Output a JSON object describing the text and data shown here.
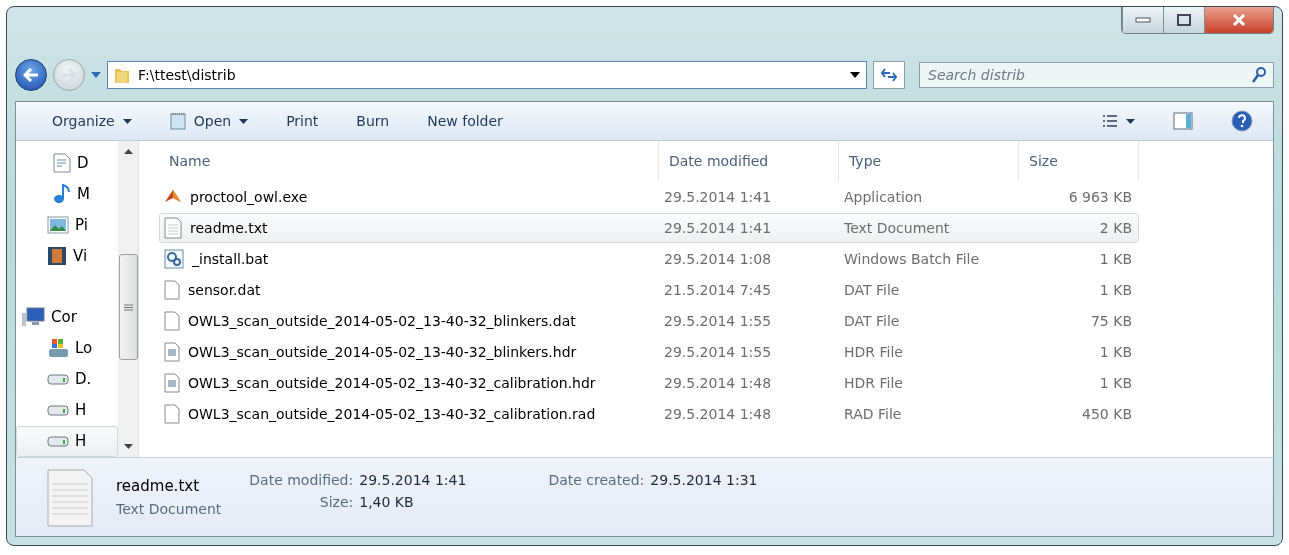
{
  "address": {
    "path": "F:\\ttest\\distrib"
  },
  "search": {
    "placeholder": "Search distrib"
  },
  "toolbar": [
    {
      "label": "Organize",
      "kind": "menu"
    },
    {
      "label": "Open",
      "kind": "open"
    },
    {
      "label": "Print",
      "kind": "plain"
    },
    {
      "label": "Burn",
      "kind": "plain"
    },
    {
      "label": "New folder",
      "kind": "plain"
    }
  ],
  "nav": [
    {
      "label": "D",
      "kind": "document",
      "selected": false
    },
    {
      "label": "M",
      "kind": "music",
      "selected": false
    },
    {
      "label": "Pi",
      "kind": "pictures",
      "selected": false
    },
    {
      "label": "Vi",
      "kind": "videos",
      "selected": false
    },
    {
      "label": "Cor",
      "kind": "computer",
      "selected": false
    },
    {
      "label": "Lo",
      "kind": "systemdrive",
      "selected": false
    },
    {
      "label": "D.",
      "kind": "drive",
      "selected": false
    },
    {
      "label": "H",
      "kind": "drive",
      "selected": false
    },
    {
      "label": "H",
      "kind": "drive",
      "selected": true
    }
  ],
  "columns": [
    "Name",
    "Date modified",
    "Type",
    "Size"
  ],
  "files": [
    {
      "name": "proctool_owl.exe",
      "date": "29.5.2014 1:41",
      "type": "Application",
      "size": "6 963 KB",
      "kind": "app",
      "selected": false
    },
    {
      "name": "readme.txt",
      "date": "29.5.2014 1:41",
      "type": "Text Document",
      "size": "2 KB",
      "kind": "text",
      "selected": true
    },
    {
      "name": "_install.bat",
      "date": "29.5.2014 1:08",
      "type": "Windows Batch File",
      "size": "1 KB",
      "kind": "batch",
      "selected": false
    },
    {
      "name": "sensor.dat",
      "date": "21.5.2014 7:45",
      "type": "DAT File",
      "size": "1 KB",
      "kind": "blank",
      "selected": false
    },
    {
      "name": "OWL3_scan_outside_2014-05-02_13-40-32_blinkers.dat",
      "date": "29.5.2014 1:55",
      "type": "DAT File",
      "size": "75 KB",
      "kind": "blank",
      "selected": false
    },
    {
      "name": "OWL3_scan_outside_2014-05-02_13-40-32_blinkers.hdr",
      "date": "29.5.2014 1:55",
      "type": "HDR File",
      "size": "1 KB",
      "kind": "header",
      "selected": false
    },
    {
      "name": "OWL3_scan_outside_2014-05-02_13-40-32_calibration.hdr",
      "date": "29.5.2014 1:48",
      "type": "HDR File",
      "size": "1 KB",
      "kind": "header",
      "selected": false
    },
    {
      "name": "OWL3_scan_outside_2014-05-02_13-40-32_calibration.rad",
      "date": "29.5.2014 1:48",
      "type": "RAD File",
      "size": "450 KB",
      "kind": "blank",
      "selected": false
    }
  ],
  "details": {
    "name": "readme.txt",
    "type": "Text Document",
    "fields": [
      {
        "label": "Date modified:",
        "value": "29.5.2014 1:41"
      },
      {
        "label": "Size:",
        "value": "1,40 KB"
      },
      {
        "label": "Date created:",
        "value": "29.5.2014 1:31"
      }
    ]
  }
}
